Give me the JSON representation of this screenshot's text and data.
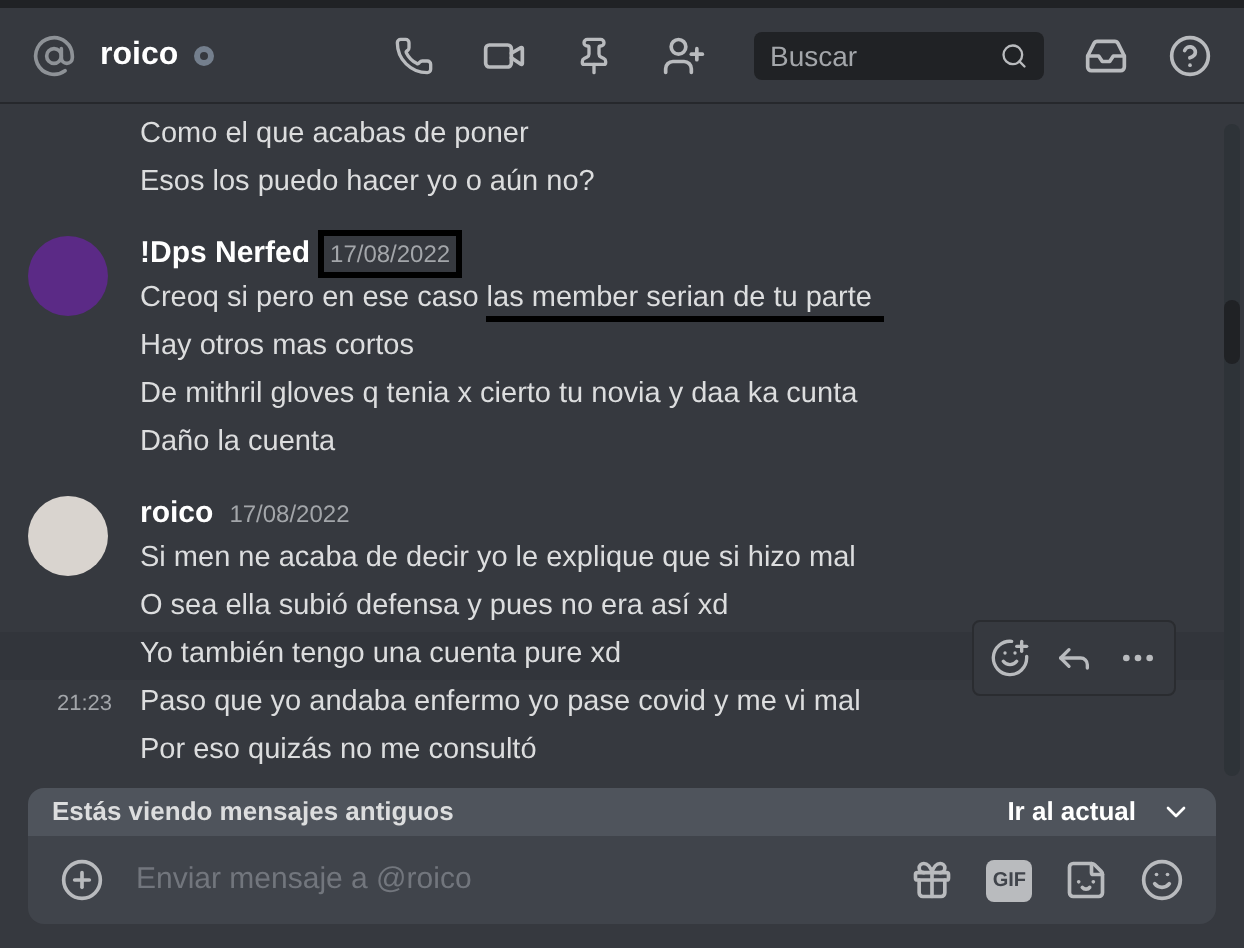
{
  "header": {
    "channel": "roico",
    "offline": true,
    "search": {
      "placeholder": "Buscar"
    }
  },
  "messages": [
    {
      "kind": "continuation",
      "lines": [
        {
          "text": "Como el que acabas de poner"
        },
        {
          "text": "Esos los puedo hacer yo o aún no?"
        }
      ]
    },
    {
      "kind": "group",
      "author": "!Dps Nerfed",
      "date": "17/08/2022",
      "date_boxed": true,
      "color": "#5b2a86",
      "lines": [
        {
          "text": "Creoq si pero en ese caso ",
          "underlined": "las member serian de tu parte"
        },
        {
          "text": "Hay otros mas cortos"
        },
        {
          "text": "De mithril gloves  q tenia x cierto tu novia y daa ka cunta"
        },
        {
          "text": "Daño la cuenta"
        }
      ]
    },
    {
      "kind": "group",
      "author": "roico",
      "date": "17/08/2022",
      "date_boxed": false,
      "color": "#d9d4cf",
      "lines": [
        {
          "text": "Si men ne acaba de decir yo le explique que si hizo mal"
        },
        {
          "text": "O sea ella subió defensa y pues no era así xd"
        },
        {
          "text": "Yo también tengo una cuenta pure xd",
          "hovered": true
        },
        {
          "text": "Paso que yo andaba enfermo yo pase covid y me vi mal",
          "time": "21:23"
        },
        {
          "text": "Por eso quizás no me consultó"
        }
      ]
    }
  ],
  "banner": {
    "text": "Estás viendo mensajes antiguos",
    "action": "Ir al actual"
  },
  "composer": {
    "placeholder": "Enviar mensaje a @roico",
    "gif": "GIF"
  }
}
